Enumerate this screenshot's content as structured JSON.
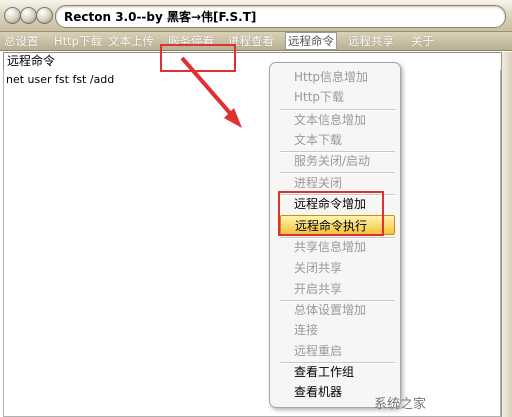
{
  "window": {
    "title": "Recton 3.0--by 黑客→伟[F.S.T]"
  },
  "menu": {
    "items": [
      "总设置",
      "Http下载",
      "文本上传",
      "服务停看",
      "进程查看",
      "远程命令",
      "远程共享",
      "关于"
    ],
    "active_index": 5
  },
  "panel": {
    "title": "远程命令",
    "command": "net user fst fst /add"
  },
  "context_menu": {
    "items": [
      {
        "label": "Http信息增加",
        "enabled": false
      },
      {
        "label": "Http下载",
        "enabled": false
      },
      {
        "label": "文本信息增加",
        "enabled": false
      },
      {
        "label": "文本下载",
        "enabled": false
      },
      {
        "label": "服务关闭/启动",
        "enabled": false
      },
      {
        "label": "进程关闭",
        "enabled": false
      },
      {
        "label": "远程命令增加",
        "enabled": true
      },
      {
        "label": "远程命令执行",
        "enabled": true,
        "highlighted": true
      },
      {
        "label": "共享信息增加",
        "enabled": false
      },
      {
        "label": "关闭共享",
        "enabled": false
      },
      {
        "label": "开启共享",
        "enabled": false
      },
      {
        "label": "总体设置增加",
        "enabled": false
      },
      {
        "label": "连接",
        "enabled": false
      },
      {
        "label": "远程重启",
        "enabled": false
      },
      {
        "label": "查看工作组",
        "enabled": true
      },
      {
        "label": "查看机器",
        "enabled": true
      }
    ]
  },
  "watermark": "系统之家",
  "colors": {
    "annotation": "#e03030",
    "highlight": "#f3c43c",
    "titlebar": "#d8d0b8"
  }
}
